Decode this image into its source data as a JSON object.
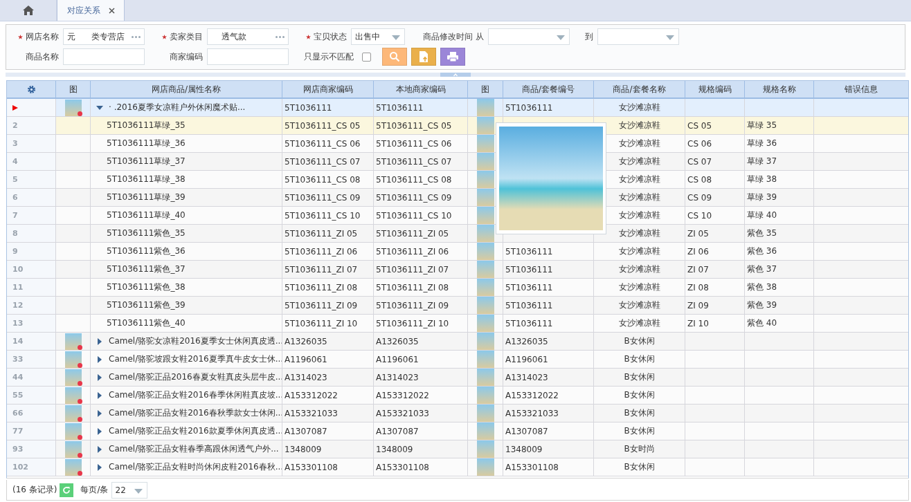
{
  "tabs": [
    {
      "kind": "home",
      "selected": false
    },
    {
      "kind": "page",
      "label": "对应关系",
      "closable": true,
      "selected": true
    }
  ],
  "filters": {
    "shop_name": {
      "label": "网店名称",
      "required": true,
      "value": "元      类专营店"
    },
    "seller_category": {
      "label": "卖家类目",
      "required": true,
      "value": "透气款"
    },
    "item_status": {
      "label": "宝贝状态",
      "required": true,
      "value": "出售中"
    },
    "modified_time": {
      "label": "商品修改时间 从",
      "to_label": "到"
    },
    "product_name": {
      "label": "商品名称"
    },
    "merchant_code": {
      "label": "商家编码"
    },
    "only_unmatched": {
      "label": "只显示不匹配",
      "checked": false
    }
  },
  "table": {
    "columns": [
      "图",
      "网店商品/属性名称",
      "网店商家编码",
      "本地商家编码",
      "图",
      "商品/套餐编号",
      "商品/套餐名称",
      "规格编码",
      "规格名称",
      "错误信息"
    ],
    "rows": [
      {
        "kind": "parent",
        "selected": true,
        "hovered": false,
        "expanded": true,
        "name": "·         .2016夏季女凉鞋户外休闲魔术贴...",
        "shop_code": "5T1036111",
        "local_code": "5T1036111",
        "pkg_code": "5T1036111",
        "pkg_name": "女沙滩凉鞋"
      },
      {
        "kind": "child",
        "selected": false,
        "hovered": true,
        "num": "2",
        "name": "5T1036111草绿_35",
        "shop_code": "5T1036111_CS 05",
        "local_code": "5T1036111_CS 05",
        "pkg_name": "女沙滩凉鞋",
        "spec_code": "CS 05",
        "spec_name": "草绿 35"
      },
      {
        "kind": "child",
        "selected": false,
        "hovered": false,
        "num": "3",
        "name": "5T1036111草绿_36",
        "shop_code": "5T1036111_CS 06",
        "local_code": "5T1036111_CS 06",
        "pkg_name": "女沙滩凉鞋",
        "spec_code": "CS 06",
        "spec_name": "草绿 36"
      },
      {
        "kind": "child",
        "selected": false,
        "hovered": false,
        "num": "4",
        "name": "5T1036111草绿_37",
        "shop_code": "5T1036111_CS 07",
        "local_code": "5T1036111_CS 07",
        "pkg_name": "女沙滩凉鞋",
        "spec_code": "CS 07",
        "spec_name": "草绿 37"
      },
      {
        "kind": "child",
        "selected": false,
        "hovered": false,
        "num": "5",
        "name": "5T1036111草绿_38",
        "shop_code": "5T1036111_CS 08",
        "local_code": "5T1036111_CS 08",
        "pkg_name": "女沙滩凉鞋",
        "spec_code": "CS 08",
        "spec_name": "草绿 38"
      },
      {
        "kind": "child",
        "selected": false,
        "hovered": false,
        "num": "6",
        "name": "5T1036111草绿_39",
        "shop_code": "5T1036111_CS 09",
        "local_code": "5T1036111_CS 09",
        "pkg_name": "女沙滩凉鞋",
        "spec_code": "CS 09",
        "spec_name": "草绿 39"
      },
      {
        "kind": "child",
        "selected": false,
        "hovered": false,
        "num": "7",
        "name": "5T1036111草绿_40",
        "shop_code": "5T1036111_CS 10",
        "local_code": "5T1036111_CS 10",
        "pkg_name": "女沙滩凉鞋",
        "spec_code": "CS 10",
        "spec_name": "草绿 40"
      },
      {
        "kind": "child",
        "selected": false,
        "hovered": false,
        "num": "8",
        "name": "5T1036111紫色_35",
        "shop_code": "5T1036111_ZI 05",
        "local_code": "5T1036111_ZI 05",
        "pkg_name": "女沙滩凉鞋",
        "spec_code": "ZI 05",
        "spec_name": "紫色 35"
      },
      {
        "kind": "child",
        "selected": false,
        "hovered": false,
        "num": "9",
        "name": "5T1036111紫色_36",
        "shop_code": "5T1036111_ZI 06",
        "local_code": "5T1036111_ZI 06",
        "pkg_code": "5T1036111",
        "pkg_name": "女沙滩凉鞋",
        "spec_code": "ZI 06",
        "spec_name": "紫色 36"
      },
      {
        "kind": "child",
        "selected": false,
        "hovered": false,
        "num": "10",
        "name": "5T1036111紫色_37",
        "shop_code": "5T1036111_ZI 07",
        "local_code": "5T1036111_ZI 07",
        "pkg_code": "5T1036111",
        "pkg_name": "女沙滩凉鞋",
        "spec_code": "ZI 07",
        "spec_name": "紫色 37"
      },
      {
        "kind": "child",
        "selected": false,
        "hovered": false,
        "num": "11",
        "name": "5T1036111紫色_38",
        "shop_code": "5T1036111_ZI 08",
        "local_code": "5T1036111_ZI 08",
        "pkg_code": "5T1036111",
        "pkg_name": "女沙滩凉鞋",
        "spec_code": "ZI 08",
        "spec_name": "紫色 38"
      },
      {
        "kind": "child",
        "selected": false,
        "hovered": false,
        "num": "12",
        "name": "5T1036111紫色_39",
        "shop_code": "5T1036111_ZI 09",
        "local_code": "5T1036111_ZI 09",
        "pkg_code": "5T1036111",
        "pkg_name": "女沙滩凉鞋",
        "spec_code": "ZI 09",
        "spec_name": "紫色 39"
      },
      {
        "kind": "child",
        "selected": false,
        "hovered": false,
        "num": "13",
        "name": "5T1036111紫色_40",
        "shop_code": "5T1036111_ZI 10",
        "local_code": "5T1036111_ZI 10",
        "pkg_code": "5T1036111",
        "pkg_name": "女沙滩凉鞋",
        "spec_code": "ZI 10",
        "spec_name": "紫色 40"
      },
      {
        "kind": "parent",
        "selected": false,
        "hovered": false,
        "expanded": false,
        "num": "14",
        "name": "Camel/骆驼女凉鞋2016夏季女士休闲真皮透...",
        "shop_code": "A1326035",
        "local_code": "A1326035",
        "pkg_code": "A1326035",
        "pkg_name": "B女休闲"
      },
      {
        "kind": "parent",
        "selected": false,
        "hovered": false,
        "expanded": false,
        "num": "33",
        "name": "Camel/骆驼坡跟女鞋2016夏季真牛皮女士休...",
        "shop_code": "A1196061",
        "local_code": "A1196061",
        "pkg_code": "A1196061",
        "pkg_name": "B女休闲"
      },
      {
        "kind": "parent",
        "selected": false,
        "hovered": false,
        "expanded": false,
        "num": "44",
        "name": "Camel/骆驼正品2016春夏女鞋真皮头层牛皮...",
        "shop_code": "A1314023",
        "local_code": "A1314023",
        "pkg_code": "A1314023",
        "pkg_name": "B女休闲"
      },
      {
        "kind": "parent",
        "selected": false,
        "hovered": false,
        "expanded": false,
        "num": "55",
        "name": "Camel/骆驼正品女鞋2016春季休闲鞋真皮坡...",
        "shop_code": "A153312022",
        "local_code": "A153312022",
        "pkg_code": "A153312022",
        "pkg_name": "B女休闲"
      },
      {
        "kind": "parent",
        "selected": false,
        "hovered": false,
        "expanded": false,
        "num": "66",
        "name": "Camel/骆驼正品女鞋2016春秋季款女士休闲...",
        "shop_code": "A153321033",
        "local_code": "A153321033",
        "pkg_code": "A153321033",
        "pkg_name": "B女休闲"
      },
      {
        "kind": "parent",
        "selected": false,
        "hovered": false,
        "expanded": false,
        "num": "77",
        "name": "Camel/骆驼正品女鞋2016款夏季休闲真皮透...",
        "shop_code": "A1307087",
        "local_code": "A1307087",
        "pkg_code": "A1307087",
        "pkg_name": "B女休闲"
      },
      {
        "kind": "parent",
        "selected": false,
        "hovered": false,
        "expanded": false,
        "num": "93",
        "name": "Camel/骆驼正品女鞋春季高跟休闲透气户外...",
        "shop_code": "1348009",
        "local_code": "1348009",
        "pkg_code": "1348009",
        "pkg_name": "B女时尚"
      },
      {
        "kind": "parent",
        "selected": false,
        "hovered": false,
        "expanded": false,
        "num": "102",
        "name": "Camel/骆驼正品女鞋时尚休闲皮鞋2016春秋...",
        "shop_code": "A153301108",
        "local_code": "A153301108",
        "pkg_code": "A153301108",
        "pkg_name": "B女休闲"
      }
    ]
  },
  "footer": {
    "record_count": "(16 条记录)",
    "page_size_label": "每页/条",
    "page_size": "22"
  }
}
